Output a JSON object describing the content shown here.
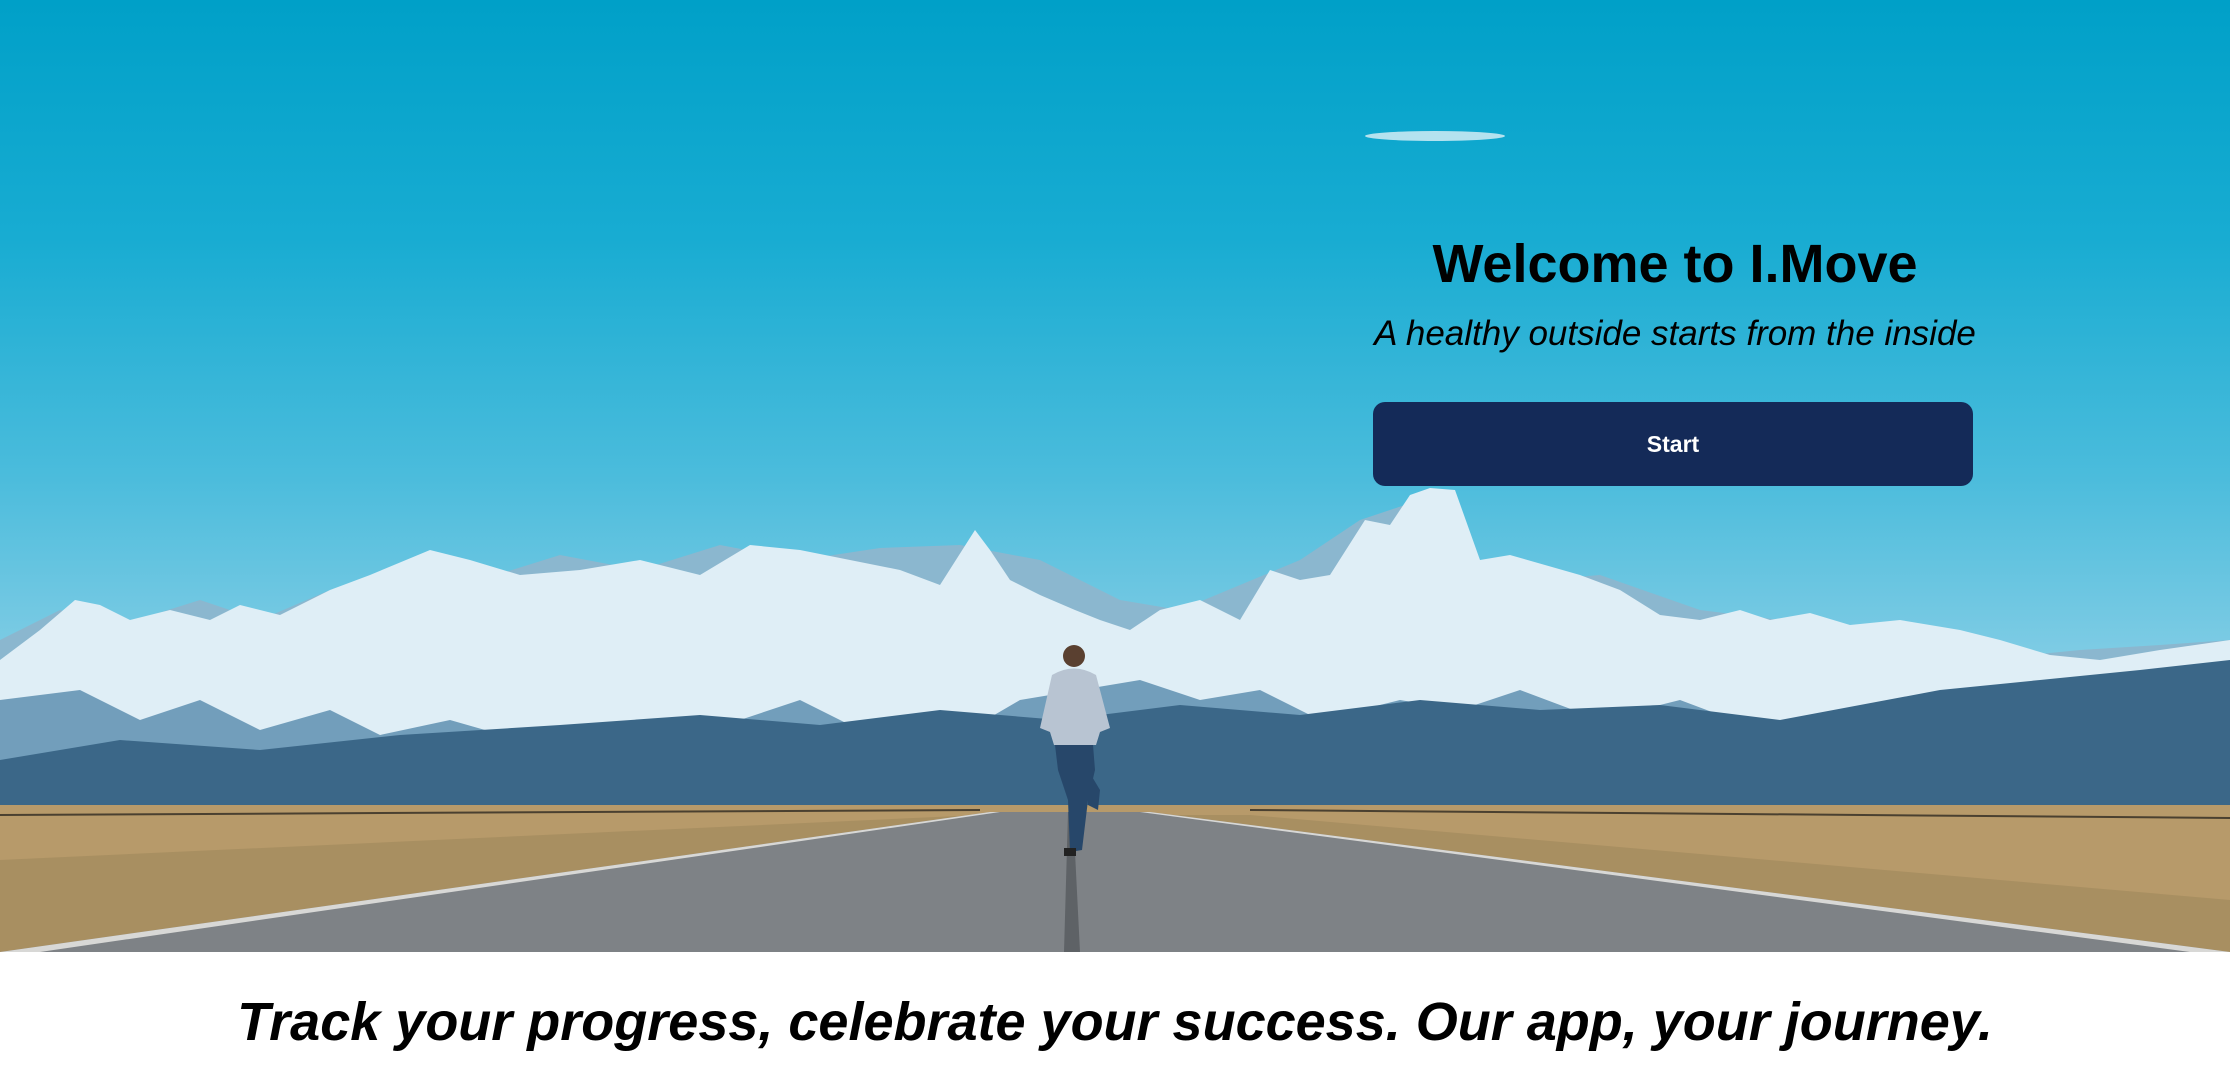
{
  "hero": {
    "title": "Welcome to I.Move",
    "tagline": "A healthy outside starts from the inside",
    "start_label": "Start"
  },
  "footer": {
    "slogan": "Track your progress, celebrate your success. Our app, your journey."
  },
  "colors": {
    "button_bg": "#142a58",
    "sky_top": "#00a0c8",
    "sky_bottom": "#b4dfee"
  }
}
